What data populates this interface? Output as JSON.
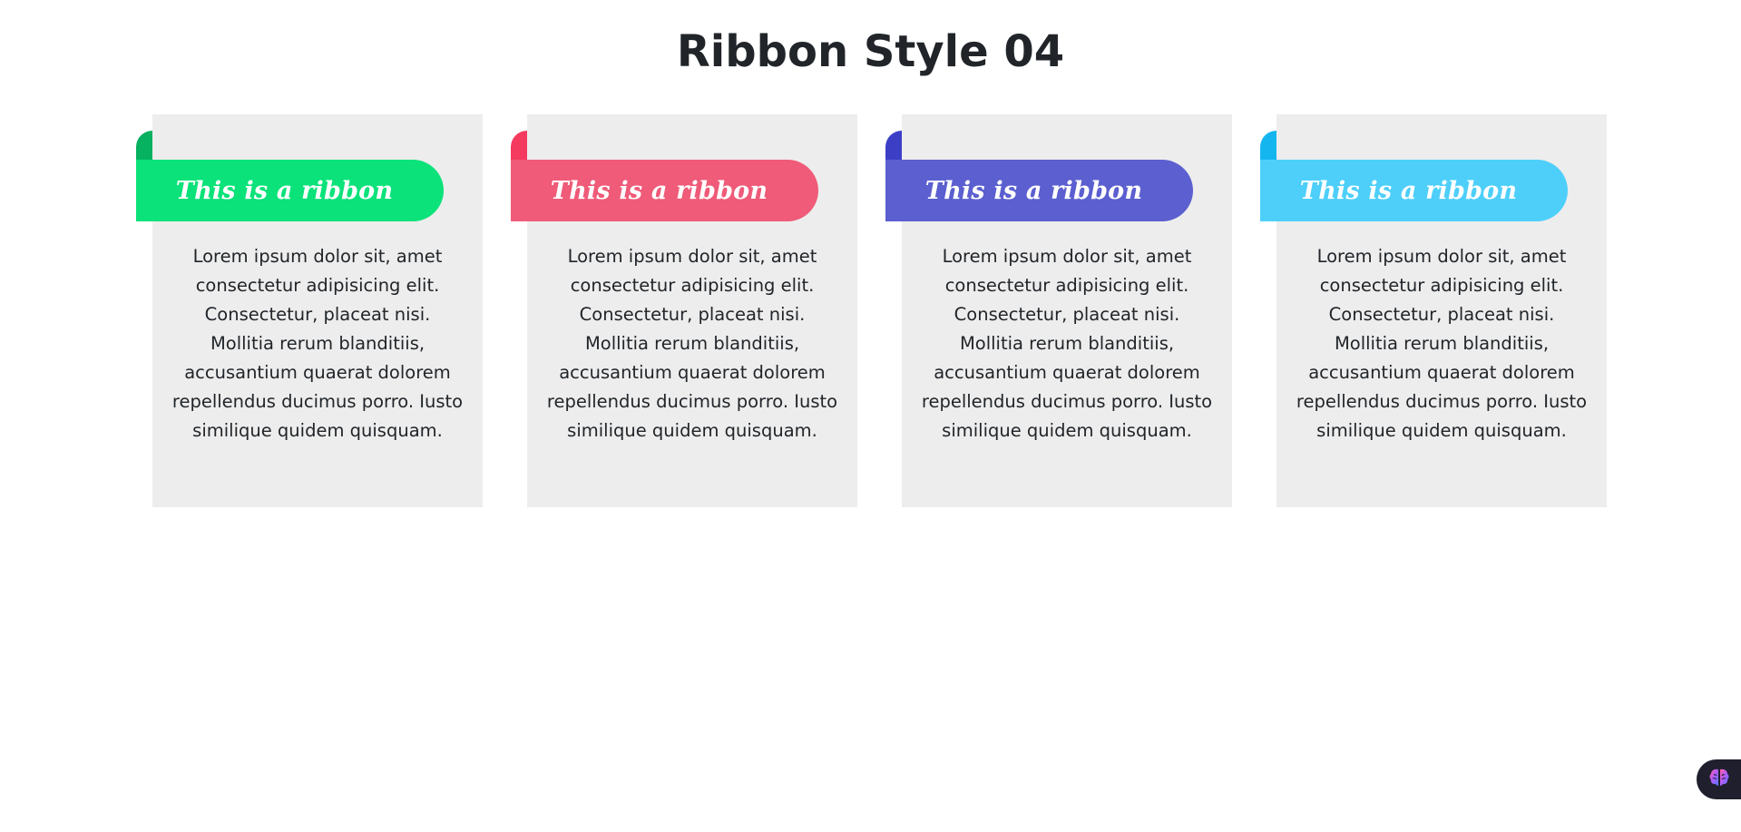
{
  "header": {
    "title": "Ribbon Style 04"
  },
  "cards": [
    {
      "ribbon_label": "This is a ribbon",
      "ribbon_color": "#0be27a",
      "fold_color": "#06b15f",
      "text": "Lorem ipsum dolor sit, amet consectetur adipisicing elit. Consectetur, placeat nisi. Mollitia rerum blanditiis, accusantium quaerat dolorem repellendus ducimus porro. Iusto similique quidem quisquam."
    },
    {
      "ribbon_label": "This is a ribbon",
      "ribbon_color": "#ef5b78",
      "fold_color": "#f43a5f",
      "text": "Lorem ipsum dolor sit, amet consectetur adipisicing elit. Consectetur, placeat nisi. Mollitia rerum blanditiis, accusantium quaerat dolorem repellendus ducimus porro. Iusto similique quidem quisquam."
    },
    {
      "ribbon_label": "This is a ribbon",
      "ribbon_color": "#5b5fcf",
      "fold_color": "#3c3fc6",
      "text": "Lorem ipsum dolor sit, amet consectetur adipisicing elit. Consectetur, placeat nisi. Mollitia rerum blanditiis, accusantium quaerat dolorem repellendus ducimus porro. Iusto similique quidem quisquam."
    },
    {
      "ribbon_label": "This is a ribbon",
      "ribbon_color": "#4dcffa",
      "fold_color": "#15b6f0",
      "text": "Lorem ipsum dolor sit, amet consectetur adipisicing elit. Consectetur, placeat nisi. Mollitia rerum blanditiis, accusantium quaerat dolorem repellendus ducimus porro. Iusto similique quidem quisquam."
    }
  ],
  "floating_button": {
    "icon": "brain-icon"
  }
}
